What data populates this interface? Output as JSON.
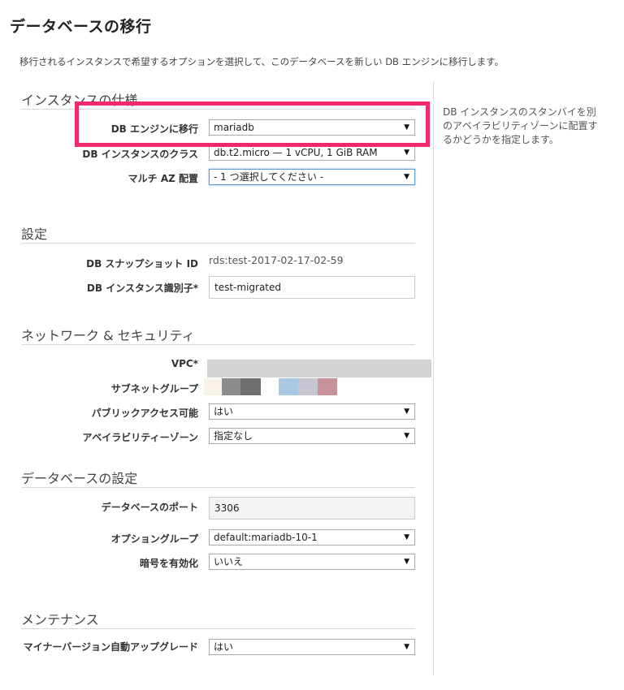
{
  "page": {
    "title": "データベースの移行",
    "description": "移行されるインスタンスで希望するオプションを選択して、このデータベースを新しい DB エンジンに移行します。"
  },
  "help_text": "DB インスタンスのスタンバイを別のアベイラビリティゾーンに配置するかどうかを指定します。",
  "sections": {
    "instance_spec": {
      "title": "インスタンスの仕様",
      "db_engine_label": "DB エンジンに移行",
      "db_engine_value": "mariadb",
      "instance_class_label": "DB インスタンスのクラス",
      "instance_class_value": "db.t2.micro — 1 vCPU, 1 GiB RAM",
      "multi_az_label": "マルチ AZ 配置",
      "multi_az_value": "- 1 つ選択してください -"
    },
    "settings": {
      "title": "設定",
      "snapshot_id_label": "DB スナップショット ID",
      "snapshot_id_value": "rds:test-2017-02-17-02-59",
      "instance_id_label": "DB インスタンス識別子*",
      "instance_id_value": "test-migrated"
    },
    "network": {
      "title": "ネットワーク & セキュリティ",
      "vpc_label": "VPC*",
      "subnet_label": "サブネットグループ",
      "public_label": "パブリックアクセス可能",
      "public_value": "はい",
      "az_label": "アベイラビリティーゾーン",
      "az_value": "指定なし"
    },
    "database": {
      "title": "データベースの設定",
      "port_label": "データベースのポート",
      "port_value": "3306",
      "option_group_label": "オプショングループ",
      "option_group_value": "default:mariadb-10-1",
      "encryption_label": "暗号を有効化",
      "encryption_value": "いいえ"
    },
    "maintenance": {
      "title": "メンテナンス",
      "minor_upgrade_label": "マイナーバージョン自動アップグレード",
      "minor_upgrade_value": "はい"
    }
  },
  "colors": {
    "highlight": "#ee2a6b",
    "focus": "#5b9dd9",
    "swatches": [
      "#faf3e8",
      "#8c8c8c",
      "#707070",
      "#ffffff",
      "#a9c8e4",
      "#c7c5d1",
      "#c7929a"
    ]
  },
  "icons": {
    "dropdown": "triangle-down-icon"
  }
}
